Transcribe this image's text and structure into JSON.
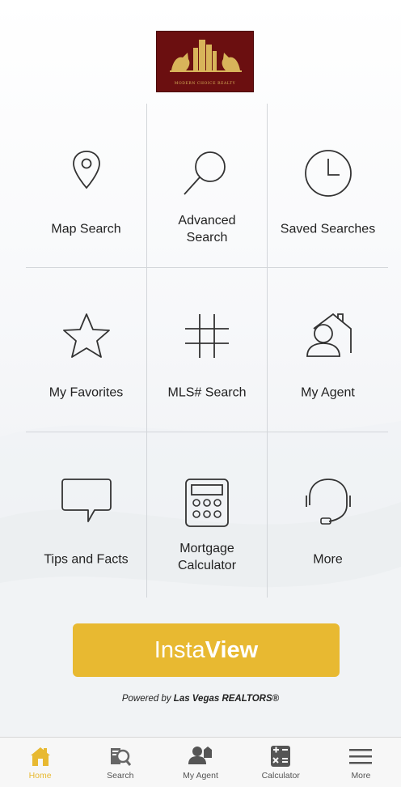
{
  "logo": {
    "text": "MODERN CHOICE REALTY",
    "bg": "#6b0f10",
    "gold": "#d8b45a"
  },
  "grid": [
    {
      "label": "Map Search",
      "lines": [
        "Map Search"
      ],
      "icon": "map-pin-icon"
    },
    {
      "label": "Advanced Search",
      "lines": [
        "Advanced",
        "Search"
      ],
      "icon": "magnifier-icon"
    },
    {
      "label": "Saved Searches",
      "lines": [
        "Saved Searches"
      ],
      "icon": "clock-icon"
    },
    {
      "label": "My Favorites",
      "lines": [
        "My Favorites"
      ],
      "icon": "star-icon"
    },
    {
      "label": "MLS# Search",
      "lines": [
        "MLS# Search"
      ],
      "icon": "hash-icon"
    },
    {
      "label": "My Agent",
      "lines": [
        "My Agent"
      ],
      "icon": "agent-house-icon"
    },
    {
      "label": "Tips and Facts",
      "lines": [
        "Tips and Facts"
      ],
      "icon": "speech-bubble-icon"
    },
    {
      "label": "Mortgage Calculator",
      "lines": [
        "Mortgage",
        "Calculator"
      ],
      "icon": "calculator-icon"
    },
    {
      "label": "More",
      "lines": [
        "More"
      ],
      "icon": "headset-icon"
    }
  ],
  "insta": {
    "light": "Insta",
    "bold": "View",
    "color": "#e8b931"
  },
  "powered": {
    "prefix": "Powered by ",
    "brand": "Las Vegas REALTORS®"
  },
  "tabs": [
    {
      "label": "Home",
      "icon": "home-icon",
      "active": true
    },
    {
      "label": "Search",
      "icon": "search-listing-icon",
      "active": false
    },
    {
      "label": "My Agent",
      "icon": "agent-icon",
      "active": false
    },
    {
      "label": "Calculator",
      "icon": "calculator-tab-icon",
      "active": false
    },
    {
      "label": "More",
      "icon": "menu-icon",
      "active": false
    }
  ]
}
